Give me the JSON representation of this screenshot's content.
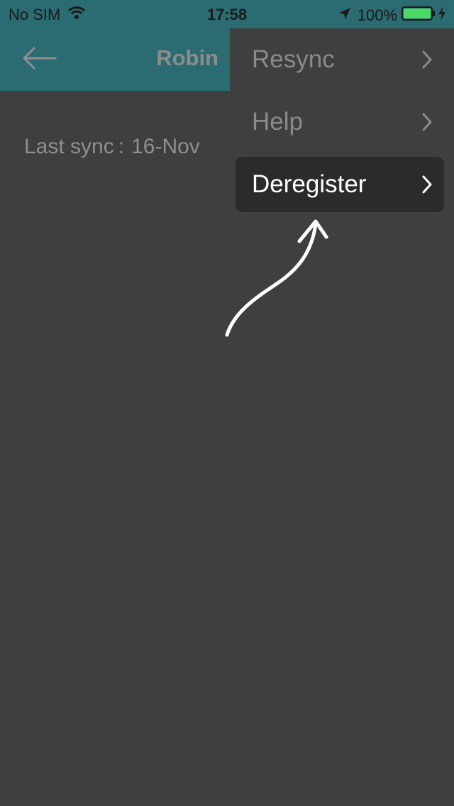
{
  "status_bar": {
    "carrier": "No SIM",
    "time": "17:58",
    "battery_percent": "100%"
  },
  "app_bar": {
    "title": "Robin"
  },
  "main": {
    "last_sync_label": "Last sync",
    "last_sync_separator": ":",
    "last_sync_value": "16-Nov"
  },
  "menu": {
    "items": [
      {
        "label": "Resync"
      },
      {
        "label": "Help"
      },
      {
        "label": "Deregister"
      }
    ]
  },
  "colors": {
    "header": "#2b6b72",
    "background": "#3f3f3f",
    "highlight": "#2b2b2b",
    "battery": "#4cd964"
  }
}
